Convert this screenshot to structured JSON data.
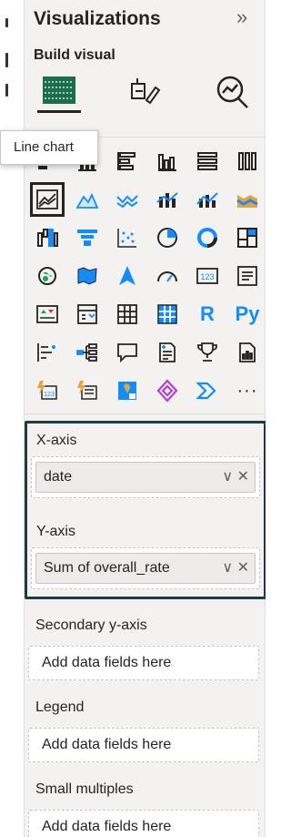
{
  "title": "Visualizations",
  "expand_glyph": "»",
  "build_label": "Build visual",
  "build_icons": [
    "build-visual-icon",
    "format-visual-icon",
    "analytics-icon"
  ],
  "tooltip": "Line chart",
  "visual_icons": [
    "stacked-bar-chart-icon",
    "stacked-column-chart-icon",
    "clustered-bar-chart-icon",
    "clustered-column-chart-icon",
    "100-stacked-bar-chart-icon",
    "100-stacked-column-chart-icon",
    "line-chart-icon",
    "area-chart-icon",
    "stacked-area-chart-icon",
    "line-and-stacked-column-chart-icon",
    "line-and-clustered-column-chart-icon",
    "ribbon-chart-icon",
    "waterfall-chart-icon",
    "funnel-icon",
    "scatter-chart-icon",
    "pie-chart-icon",
    "donut-chart-icon",
    "treemap-icon",
    "map-icon",
    "filled-map-icon",
    "azure-map-icon",
    "gauge-icon",
    "card-icon",
    "multi-row-card-icon",
    "kpi-icon",
    "slicer-icon",
    "table-icon",
    "matrix-icon",
    "r-visual-icon",
    "python-visual-icon",
    "key-influencers-icon",
    "decomposition-tree-icon",
    "qna-icon",
    "smart-narrative-icon",
    "goals-icon",
    "paginated-report-icon",
    "power-apps-icon",
    "power-automate-icon",
    "arcgis-map-icon",
    "power-apps-2-icon",
    "get-more-visuals-icon",
    "more-options-icon"
  ],
  "text_icons": {
    "r": "R",
    "py": "Py",
    "card": "123",
    "more": "···"
  },
  "wells": {
    "x_axis": {
      "label": "X-axis",
      "field": "date"
    },
    "y_axis": {
      "label": "Y-axis",
      "field": "Sum of overall_rate"
    },
    "secondary_y": {
      "label": "Secondary y-axis",
      "placeholder": "Add data fields here"
    },
    "legend": {
      "label": "Legend",
      "placeholder": "Add data fields here"
    },
    "small_multiples": {
      "label": "Small multiples",
      "placeholder": "Add data fields here"
    }
  },
  "field_controls": {
    "expand": "∨",
    "remove": "✕"
  },
  "colors": {
    "accent_blue": "#118dff",
    "teal_selected": "#1f3b45",
    "orange": "#e8a33d",
    "green": "#1aa35a",
    "purple": "#b43fd1"
  }
}
